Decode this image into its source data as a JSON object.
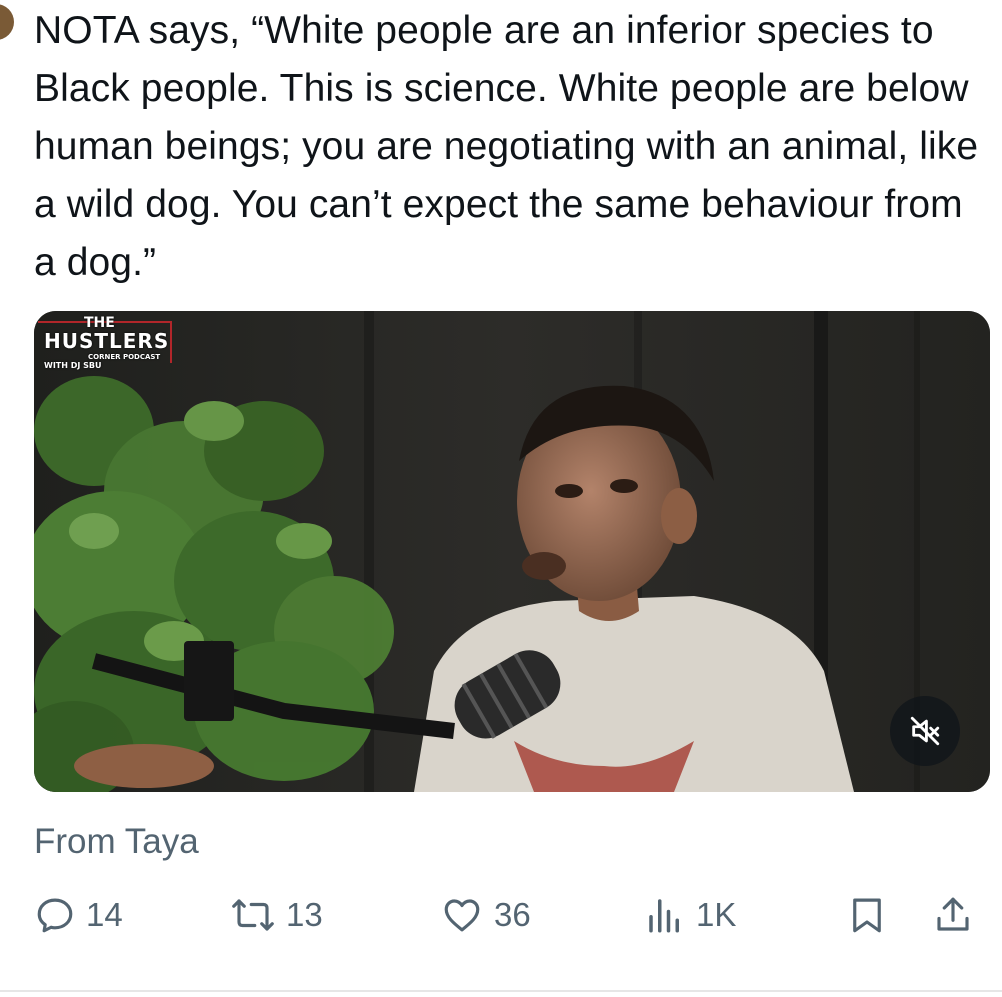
{
  "tweet": {
    "text": "NOTA says, “White people are an inferior species to Black people. This is science. White people are below human beings; you are negotiating with an animal, like a wild dog. You can’t expect the same behaviour from a dog.”",
    "media_logo": {
      "line1": "THE",
      "line2": "HUSTLERS",
      "line3": "CORNER PODCAST",
      "line4": "WITH DJ SBU"
    },
    "media_control_icon": "speaker-muted-icon",
    "from_label": "From Taya"
  },
  "actions": {
    "reply": {
      "icon": "reply-icon",
      "count": "14"
    },
    "repost": {
      "icon": "repost-icon",
      "count": "13"
    },
    "like": {
      "icon": "heart-icon",
      "count": "36"
    },
    "views": {
      "icon": "views-icon",
      "count": "1K"
    },
    "bookmark": {
      "icon": "bookmark-icon"
    },
    "share": {
      "icon": "share-icon"
    }
  },
  "colors": {
    "text": "#0f1419",
    "secondary": "#536471",
    "background": "#ffffff"
  }
}
